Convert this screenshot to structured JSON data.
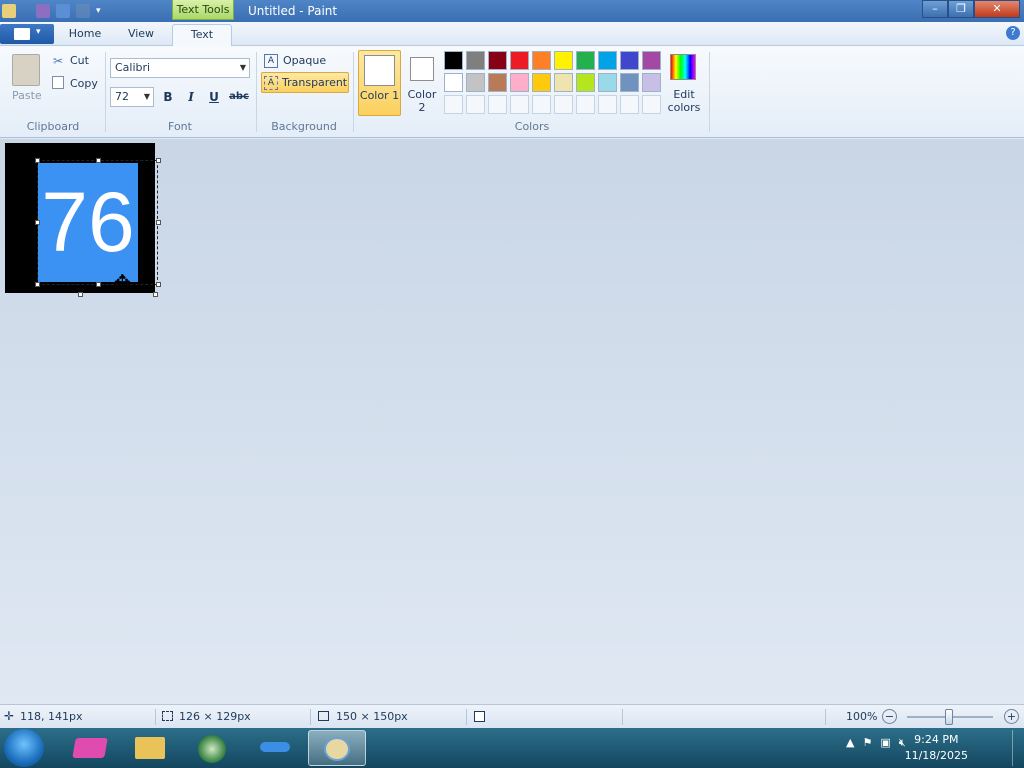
{
  "window": {
    "title": "Untitled - Paint",
    "context_tab": "Text Tools",
    "controls": [
      "–",
      "❐",
      "✕"
    ]
  },
  "tabs": [
    {
      "label": "Home"
    },
    {
      "label": "View"
    },
    {
      "label": "Text"
    }
  ],
  "ribbon": {
    "clipboard": {
      "paste": "Paste",
      "cut": "Cut",
      "copy": "Copy",
      "group": "Clipboard"
    },
    "font": {
      "family": "Calibri",
      "size": "72",
      "bold": "B",
      "italic": "I",
      "underline": "U",
      "strike": "abc",
      "group": "Font"
    },
    "background": {
      "opaque": "Opaque",
      "transparent": "Transparent",
      "group": "Background"
    },
    "colors": {
      "color1": "Color 1",
      "color2": "Color 2",
      "edit": "Edit colors",
      "group": "Colors",
      "row1": [
        "#000000",
        "#7f7f7f",
        "#880015",
        "#ed1c24",
        "#ff7f27",
        "#fff200",
        "#22b14c",
        "#00a2e8",
        "#3f48cc",
        "#a349a4"
      ],
      "row2": [
        "#ffffff",
        "#c3c3c3",
        "#b97a57",
        "#ffaec9",
        "#ffc90e",
        "#efe4b0",
        "#b5e61d",
        "#99d9ea",
        "#7092be",
        "#c8bfe7"
      ]
    }
  },
  "canvas": {
    "text": "76",
    "text_color": "#ffffff",
    "box_color": "#3b92f3",
    "canvas_color": "#000000"
  },
  "status": {
    "cursor": "118, 141px",
    "selection": "126 × 129px",
    "size": "150 × 150px",
    "zoom": "100%"
  },
  "clock": {
    "time": "9:24 PM",
    "date": "11/18/2025"
  }
}
